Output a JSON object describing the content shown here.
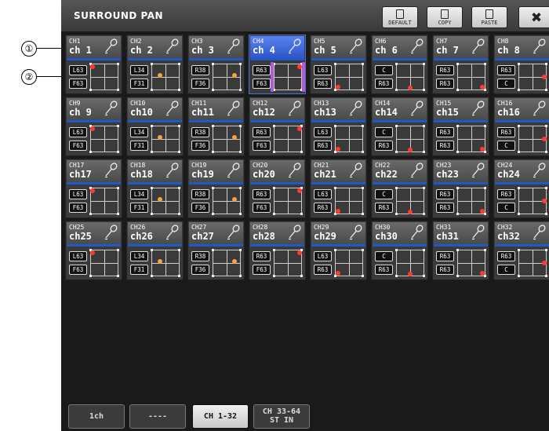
{
  "callouts": [
    "①",
    "②"
  ],
  "window": {
    "title": "SURROUND PAN",
    "buttons": {
      "default": "DEFAULT",
      "copy": "COPY",
      "paste": "PASTE",
      "close": "✖"
    }
  },
  "channels": [
    {
      "num": "CH1",
      "name": "ch 1",
      "v1": "L63",
      "v2": "F63",
      "dot": "red",
      "dx": 0.05,
      "dy": 0.08
    },
    {
      "num": "CH2",
      "name": "ch 2",
      "v1": "L34",
      "v2": "F31",
      "dot": "orange",
      "dx": 0.3,
      "dy": 0.45
    },
    {
      "num": "CH3",
      "name": "ch 3",
      "v1": "R38",
      "v2": "F36",
      "dot": "orange",
      "dx": 0.8,
      "dy": 0.45
    },
    {
      "num": "CH4",
      "name": "ch 4",
      "v1": "R63",
      "v2": "F63",
      "dot": "red",
      "dx": 0.95,
      "dy": 0.08,
      "selected": true
    },
    {
      "num": "CH5",
      "name": "ch 5",
      "v1": "L63",
      "v2": "R63",
      "dot": "red",
      "dx": 0.08,
      "dy": 0.92
    },
    {
      "num": "CH6",
      "name": "ch 6",
      "v1": "C",
      "v2": "R63",
      "dot": "red",
      "dx": 0.5,
      "dy": 0.95
    },
    {
      "num": "CH7",
      "name": "ch 7",
      "v1": "R63",
      "v2": "R63",
      "dot": "red",
      "dx": 0.92,
      "dy": 0.92
    },
    {
      "num": "CH8",
      "name": "ch 8",
      "v1": "R63",
      "v2": "C",
      "dot": "red",
      "dx": 0.95,
      "dy": 0.5
    },
    {
      "num": "CH9",
      "name": "ch 9",
      "v1": "L63",
      "v2": "F63",
      "dot": "red",
      "dx": 0.05,
      "dy": 0.08
    },
    {
      "num": "CH10",
      "name": "ch10",
      "v1": "L34",
      "v2": "F31",
      "dot": "orange",
      "dx": 0.3,
      "dy": 0.45
    },
    {
      "num": "CH11",
      "name": "ch11",
      "v1": "R38",
      "v2": "F36",
      "dot": "orange",
      "dx": 0.8,
      "dy": 0.45
    },
    {
      "num": "CH12",
      "name": "ch12",
      "v1": "R63",
      "v2": "F63",
      "dot": "red",
      "dx": 0.95,
      "dy": 0.08
    },
    {
      "num": "CH13",
      "name": "ch13",
      "v1": "L63",
      "v2": "R63",
      "dot": "red",
      "dx": 0.08,
      "dy": 0.92
    },
    {
      "num": "CH14",
      "name": "ch14",
      "v1": "C",
      "v2": "R63",
      "dot": "red",
      "dx": 0.5,
      "dy": 0.95
    },
    {
      "num": "CH15",
      "name": "ch15",
      "v1": "R63",
      "v2": "R63",
      "dot": "red",
      "dx": 0.92,
      "dy": 0.92
    },
    {
      "num": "CH16",
      "name": "ch16",
      "v1": "R63",
      "v2": "C",
      "dot": "red",
      "dx": 0.95,
      "dy": 0.5
    },
    {
      "num": "CH17",
      "name": "ch17",
      "v1": "L63",
      "v2": "F63",
      "dot": "red",
      "dx": 0.05,
      "dy": 0.08
    },
    {
      "num": "CH18",
      "name": "ch18",
      "v1": "L34",
      "v2": "F31",
      "dot": "orange",
      "dx": 0.3,
      "dy": 0.45
    },
    {
      "num": "CH19",
      "name": "ch19",
      "v1": "R38",
      "v2": "F36",
      "dot": "orange",
      "dx": 0.8,
      "dy": 0.45
    },
    {
      "num": "CH20",
      "name": "ch20",
      "v1": "R63",
      "v2": "F63",
      "dot": "red",
      "dx": 0.95,
      "dy": 0.08
    },
    {
      "num": "CH21",
      "name": "ch21",
      "v1": "L63",
      "v2": "R63",
      "dot": "red",
      "dx": 0.08,
      "dy": 0.92
    },
    {
      "num": "CH22",
      "name": "ch22",
      "v1": "C",
      "v2": "R63",
      "dot": "red",
      "dx": 0.5,
      "dy": 0.95
    },
    {
      "num": "CH23",
      "name": "ch23",
      "v1": "R63",
      "v2": "R63",
      "dot": "red",
      "dx": 0.92,
      "dy": 0.92
    },
    {
      "num": "CH24",
      "name": "ch24",
      "v1": "R63",
      "v2": "C",
      "dot": "red",
      "dx": 0.95,
      "dy": 0.5
    },
    {
      "num": "CH25",
      "name": "ch25",
      "v1": "L63",
      "v2": "F63",
      "dot": "red",
      "dx": 0.05,
      "dy": 0.08
    },
    {
      "num": "CH26",
      "name": "ch26",
      "v1": "L34",
      "v2": "F31",
      "dot": "orange",
      "dx": 0.3,
      "dy": 0.45
    },
    {
      "num": "CH27",
      "name": "ch27",
      "v1": "R38",
      "v2": "F36",
      "dot": "orange",
      "dx": 0.8,
      "dy": 0.45
    },
    {
      "num": "CH28",
      "name": "ch28",
      "v1": "R63",
      "v2": "F63",
      "dot": "red",
      "dx": 0.95,
      "dy": 0.08
    },
    {
      "num": "CH29",
      "name": "ch29",
      "v1": "L63",
      "v2": "R63",
      "dot": "red",
      "dx": 0.08,
      "dy": 0.92
    },
    {
      "num": "CH30",
      "name": "ch30",
      "v1": "C",
      "v2": "R63",
      "dot": "red",
      "dx": 0.5,
      "dy": 0.95
    },
    {
      "num": "CH31",
      "name": "ch31",
      "v1": "R63",
      "v2": "R63",
      "dot": "red",
      "dx": 0.92,
      "dy": 0.92
    },
    {
      "num": "CH32",
      "name": "ch32",
      "v1": "R63",
      "v2": "C",
      "dot": "red",
      "dx": 0.95,
      "dy": 0.5
    }
  ],
  "tabs": [
    {
      "lines": [
        "1ch"
      ],
      "active": false
    },
    {
      "lines": [
        "----"
      ],
      "active": false
    },
    {
      "lines": [
        "CH 1-32"
      ],
      "active": true
    },
    {
      "lines": [
        "CH 33-64",
        "ST IN"
      ],
      "active": false
    }
  ],
  "colors": {
    "accent": "#1f59c9",
    "selected": "#4a70d8",
    "pan_dot_red": "#ff3b30",
    "pan_dot_orange": "#f4a340"
  },
  "icons": {
    "channel": "microphone-icon",
    "default": "document-icon",
    "copy": "copy-icon",
    "paste": "clipboard-icon",
    "close": "close-icon"
  }
}
